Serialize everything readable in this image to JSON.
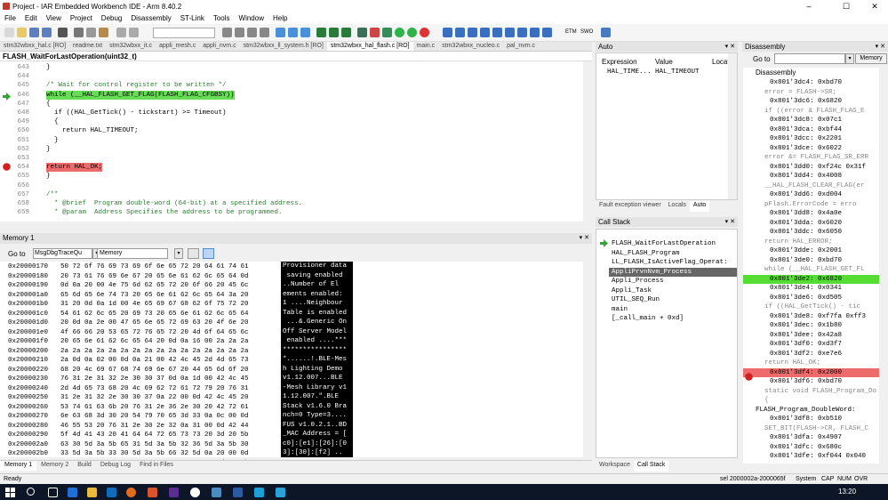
{
  "window": {
    "title": "Project - IAR Embedded Workbench IDE - Arm 8.40.2",
    "min": "–",
    "max": "☐",
    "close": "✕"
  },
  "menu": [
    "File",
    "Edit",
    "View",
    "Project",
    "Debug",
    "Disassembly",
    "ST-Link",
    "Tools",
    "Window",
    "Help"
  ],
  "toolbar": {
    "etm": "ETM",
    "swo": "SWO"
  },
  "editor": {
    "tabs": [
      "stm32wbxx_hal.c [RO]",
      "readme.txt",
      "stm32wbxx_it.c",
      "appli_mesh.c",
      "appli_nvm.c",
      "stm32wbxx_ll_system.h [RO]",
      "stm32wbxx_hal_flash.c [RO]",
      "main.c",
      "stm32wbxx_nucleo.c",
      "pal_nvm.c"
    ],
    "active_tab": "stm32wbxx_hal_flash.c [RO]",
    "function": "FLASH_WaitForLastOperation(uint32_t)",
    "lines": [
      {
        "n": "643",
        "t": "}",
        "c": ""
      },
      {
        "n": "644",
        "t": "",
        "c": ""
      },
      {
        "n": "645",
        "t": "/* Wait for control register to be written */",
        "c": "cm"
      },
      {
        "n": "646",
        "t": "while (__HAL_FLASH_GET_FLAG(FLASH_FLAG_CFGBSY))",
        "c": "hlg"
      },
      {
        "n": "647",
        "t": "{",
        "c": ""
      },
      {
        "n": "648",
        "t": "  if ((HAL_GetTick() - tickstart) >= Timeout)",
        "c": ""
      },
      {
        "n": "649",
        "t": "  {",
        "c": ""
      },
      {
        "n": "650",
        "t": "    return HAL_TIMEOUT;",
        "c": ""
      },
      {
        "n": "651",
        "t": "  }",
        "c": ""
      },
      {
        "n": "652",
        "t": "}",
        "c": ""
      },
      {
        "n": "653",
        "t": "",
        "c": ""
      },
      {
        "n": "654",
        "t": "return HAL_OK;",
        "c": "hlr"
      },
      {
        "n": "655",
        "t": "}",
        "c": ""
      },
      {
        "n": "656",
        "t": "",
        "c": ""
      },
      {
        "n": "657",
        "t": "/**",
        "c": "cm"
      },
      {
        "n": "658",
        "t": "  * @brief  Program double-word (64-bit) at a specified address.",
        "c": "cm"
      },
      {
        "n": "659",
        "t": "  * @param  Address Specifies the address to be programmed.",
        "c": "cm"
      }
    ]
  },
  "memory": {
    "title": "Memory 1",
    "goto_label": "Go to",
    "goto_value": "MsgDbgTraceQu",
    "zone": "Memory",
    "addresses": [
      "0x20000170",
      "0x20000180",
      "0x20000190",
      "0x200001a0",
      "0x200001b0",
      "0x200001c0",
      "0x200001d0",
      "0x200001e0",
      "0x200001f0",
      "0x20000200",
      "0x20000210",
      "0x20000220",
      "0x20000230",
      "0x20000240",
      "0x20000250",
      "0x20000260",
      "0x20000270",
      "0x20000280",
      "0x20000290",
      "0x200002a0",
      "0x200002b0",
      "0x200002c0"
    ],
    "hex": [
      "50 72 6f 76 69 73 69 6f 6e 65 72 20 64 61 74 61",
      "20 73 61 76 69 6e 67 20 65 6e 61 62 6c 65 64 0d",
      "0d 0a 20 00 4e 75 6d 62 65 72 20 6f 66 20 45 6c",
      "65 6d 65 6e 74 73 20 65 6e 61 62 6c 65 64 3a 20",
      "31 20 0d 0a 1d 00 4e 65 69 67 68 62 6f 75 72 20",
      "54 61 62 6c 65 20 69 73 20 65 6e 61 62 6c 65 64",
      "20 0d 0a 2e 00 47 65 6e 65 72 69 63 20 4f 6e 20",
      "4f 66 66 20 53 65 72 76 65 72 20 4d 6f 64 65 6c",
      "20 65 6e 61 62 6c 65 64 20 0d 0a 16 00 2a 2a 2a",
      "2a 2a 2a 2a 2a 2a 2a 2a 2a 2a 2a 2a 2a 2a 2a 2a",
      "2a 0d 0a 02 00 0d 0a 21 00 42 4c 45 2d 4d 65 73",
      "68 20 4c 69 67 68 74 69 6e 67 20 44 65 6d 6f 20",
      "76 31 2e 31 32 2e 30 30 37 0d 0a 1d 00 42 4c 45",
      "2d 4d 65 73 68 20 4c 69 62 72 61 72 79 20 76 31",
      "31 2e 31 32 2e 30 30 37 0a 22 00 0d 42 4c 45 20",
      "53 74 61 63 6b 20 76 31 2e 36 2e 30 20 42 72 61",
      "6e 63 68 3d 30 20 54 79 70 65 3d 33 0a 0c 00 0d",
      "46 55 53 20 76 31 2e 30 2e 32 0a 31 00 0d 42 44",
      "5f 4d 41 43 20 41 64 64 72 65 73 73 20 3d 20 5b",
      "63 30 5d 3a 5b 65 31 5d 3a 5b 32 36 5d 3a 5b 30",
      "33 5d 3a 5b 33 30 5d 3a 5b 66 32 5d 0a 20 00 0d",
      "55 55 49 44 20 41 64 64 72 65 73 73 20 3d 20 5b"
    ],
    "ascii": [
      "Provisioner data",
      " saving enabled ",
      "..Number of El",
      "ements enabled:",
      "1 ....Neighbour",
      "Table is enabled",
      " ...&.Generic On",
      "Off Server Model",
      " enabled ....***",
      "****************",
      "*......!.BLE-Mes",
      "h Lighting Demo ",
      "v1.12.007...BLE",
      "-Mesh Library v1",
      "1.12.007.\".BLE ",
      "Stack v1.6.0 Bra",
      "nch=0 Type=3....",
      "FUS v1.0.2.1..BD",
      "_MAC Address = [",
      "c0]:[e1]:[26]:[0",
      "3]:[30]:[f2] ..",
      "UUID Address = ["
    ]
  },
  "bottom_tabs": [
    "Memory 1",
    "Memory 2",
    "Build",
    "Debug Log",
    "Find in Files"
  ],
  "auto": {
    "title": "Auto",
    "col_expression": "Expression",
    "col_value": "Value",
    "col_location": "Locatio",
    "row_expr": "HAL_TIME...",
    "row_value": "HAL_TIMEOUT",
    "tabs": [
      "Fault exception viewer",
      "Locals",
      "Auto"
    ]
  },
  "callstack": {
    "title": "Call Stack",
    "frames": [
      "FLASH_WaitForLastOperation",
      "HAL_FLASH_Program",
      "LL_FLASH_IsActiveFlag_Operat:",
      "AppliPrvnNvm_Process",
      "Appli_Process",
      "Appli_Task",
      "UTIL_SEQ_Run",
      "main",
      "[_call_main + 0xd]"
    ],
    "tabs": [
      "Workspace",
      "Call Stack"
    ]
  },
  "disassembly": {
    "title": "Disassembly",
    "goto_label": "Go to",
    "zone": "Memory",
    "header": "Disassembly",
    "lines": [
      {
        "t": "0x801'3dc4: 0xbd70",
        "c": ""
      },
      {
        "t": "error = FLASH->SR;",
        "c": "src"
      },
      {
        "t": "0x801'3dc6: 0x6820",
        "c": ""
      },
      {
        "t": "if ((error & FLASH_FLAG_E",
        "c": "src"
      },
      {
        "t": "0x801'3dc8: 0x07c1",
        "c": ""
      },
      {
        "t": "0x801'3dca: 0xbf44",
        "c": ""
      },
      {
        "t": "0x801'3dcc: 0x2201",
        "c": ""
      },
      {
        "t": "0x801'3dce: 0x6022",
        "c": ""
      },
      {
        "t": "error &= FLASH_FLAG_SR_ERR",
        "c": "src"
      },
      {
        "t": "0x801'3dd0: 0xf24c 0x31f",
        "c": ""
      },
      {
        "t": "0x801'3dd4: 0x4008",
        "c": ""
      },
      {
        "t": "__HAL_FLASH_CLEAR_FLAG(er",
        "c": "src"
      },
      {
        "t": "0x801'3dd6: 0xd004",
        "c": ""
      },
      {
        "t": "pFlash.ErrorCode = erro",
        "c": "src"
      },
      {
        "t": "0x801'3dd8: 0x4a0e",
        "c": ""
      },
      {
        "t": "0x801'3dda: 0x6020",
        "c": ""
      },
      {
        "t": "0x801'3ddc: 0x6050",
        "c": ""
      },
      {
        "t": "return HAL_ERROR;",
        "c": "src"
      },
      {
        "t": "0x801'3dde: 0x2001",
        "c": ""
      },
      {
        "t": "0x801'3de0: 0xbd70",
        "c": ""
      },
      {
        "t": "while (__HAL_FLASH_GET_FL",
        "c": "src"
      },
      {
        "t": "0x801'3de2: 0x6820",
        "c": "hlg"
      },
      {
        "t": "0x801'3de4: 0x0341",
        "c": ""
      },
      {
        "t": "0x801'3de6: 0xd505",
        "c": ""
      },
      {
        "t": "if ((HAL_GetTick() - tic",
        "c": "src"
      },
      {
        "t": "0x801'3de8: 0xf7fa 0xff3",
        "c": ""
      },
      {
        "t": "0x801'3dec: 0x1b80",
        "c": ""
      },
      {
        "t": "0x801'3dee: 0x42a8",
        "c": ""
      },
      {
        "t": "0x801'3df0: 0xd3f7",
        "c": ""
      },
      {
        "t": "0x801'3df2: 0xe7e6",
        "c": ""
      },
      {
        "t": "return HAL_OK;",
        "c": "src"
      },
      {
        "t": "0x801'3df4: 0x2000",
        "c": "hlr"
      },
      {
        "t": "0x801'3df6: 0xbd70",
        "c": ""
      },
      {
        "t": "static void FLASH_Program_Do",
        "c": "src"
      },
      {
        "t": "{",
        "c": "src"
      },
      {
        "t": "FLASH_Program_DoubleWord:",
        "c": ""
      },
      {
        "t": "0x801'3df8: 0xb510",
        "c": ""
      },
      {
        "t": "SET_BIT(FLASH->CR, FLASH_C",
        "c": "src"
      },
      {
        "t": "0x801'3dfa: 0x4907",
        "c": ""
      },
      {
        "t": "0x801'3dfc: 0x680c",
        "c": ""
      },
      {
        "t": "0x801'3dfe: 0xf044 0x040",
        "c": ""
      }
    ]
  },
  "status": {
    "left": "Ready",
    "sel": "sel 2000002a-2000065f",
    "system": "System",
    "cap": "CAP",
    "num": "NUM",
    "ovr": "OVR"
  },
  "taskbar": {
    "clock": "13:20"
  }
}
